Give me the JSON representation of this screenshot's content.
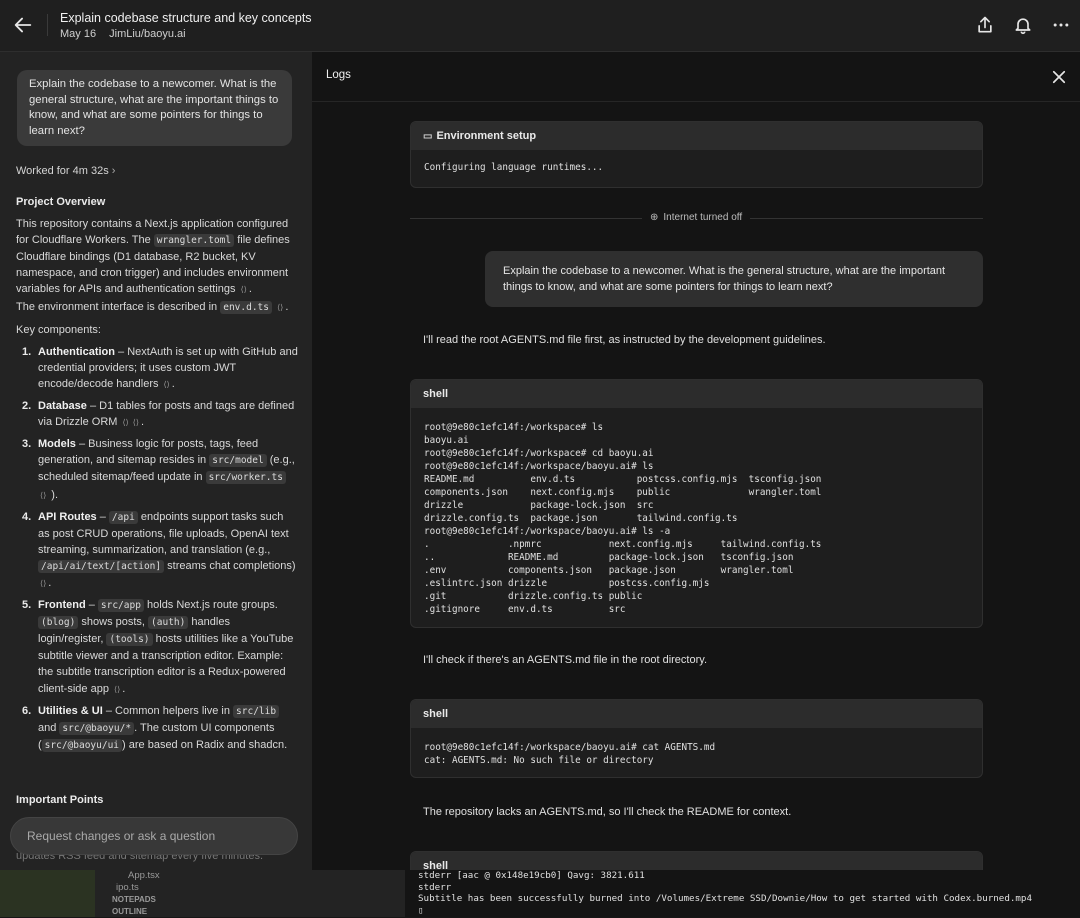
{
  "header": {
    "title": "Explain codebase structure and key concepts",
    "date": "May 16",
    "repo": "JimLiu/baoyu.ai"
  },
  "sidebar": {
    "user_prompt": "Explain the codebase to a newcomer. What is the general structure, what are the important things to know, and what are some pointers for things to learn next?",
    "worked_for": "Worked for 4m 32s",
    "overview_heading": "Project Overview",
    "overview_p1a": "This repository contains a Next.js application configured for Cloudflare Workers. The",
    "overview_code1": "wrangler.toml",
    "overview_p1b": "file defines Cloudflare bindings (D1 database, R2 bucket, KV namespace, and cron trigger) and includes environment variables for APIs and authentication settings",
    "overview_p2a": "The environment interface is described in",
    "overview_code2": "env.d.ts",
    "key_components_label": "Key components:",
    "components": [
      {
        "num": "1.",
        "name": "Authentication",
        "text": " – NextAuth is set up with GitHub and credential providers; it uses custom JWT encode/decode handlers"
      },
      {
        "num": "2.",
        "name": "Database",
        "text": " – D1 tables for posts and tags are defined via Drizzle ORM"
      },
      {
        "num": "3.",
        "name": "Models",
        "text": " – Business logic for posts, tags, feed generation, and sitemap resides in ",
        "code1": "src/model",
        "text2": " (e.g., scheduled sitemap/feed update in ",
        "code2": "src/worker.ts",
        "text3": " )."
      },
      {
        "num": "4.",
        "name": "API Routes",
        "text": " – ",
        "code1": "/api",
        "text2": " endpoints support tasks such as post CRUD operations, file uploads, OpenAI text streaming, summarization, and translation (e.g., ",
        "code2": "/api/ai/text/[action]",
        "text3": " streams chat completions)"
      },
      {
        "num": "5.",
        "name": "Frontend",
        "text": " – ",
        "code1": "src/app",
        "text2": " holds Next.js route groups. ",
        "code2": "(blog)",
        "text3": " shows posts, ",
        "code3": "(auth)",
        "text4": " handles login/register, ",
        "code4": "(tools)",
        "text5": " hosts utilities like a YouTube subtitle viewer and a transcription editor. Example: the subtitle transcription editor is a Redux-powered client-side app"
      },
      {
        "num": "6.",
        "name": "Utilities & UI",
        "text": " – Common helpers live in ",
        "code1": "src/lib",
        "text2": " and ",
        "code2": "src/@baoyu/*",
        "text3": ". The custom UI components (",
        "code3": "src/@baoyu/ui",
        "text4": ") are based on Radix and shadcn."
      }
    ],
    "important_heading": "Important Points",
    "input_placeholder": "Request changes or ask a question",
    "fade_text": "updates RSS feed and sitemap every five minutes."
  },
  "logs": {
    "title": "Logs",
    "env_card_title": "Environment setup",
    "env_card_body": "Configuring language runtimes...",
    "internet_label": "Internet turned off",
    "chat_message": "Explain the codebase to a newcomer. What is the general structure, what are the important things to know, and what are some pointers for things to learn next?",
    "narr1": "I'll read the root AGENTS.md file first, as instructed by the development guidelines.",
    "shell_label": "shell",
    "shell1": "root@9e80c1efc14f:/workspace# ls\nbaoyu.ai\nroot@9e80c1efc14f:/workspace# cd baoyu.ai\nroot@9e80c1efc14f:/workspace/baoyu.ai# ls\nREADME.md          env.d.ts           postcss.config.mjs  tsconfig.json\ncomponents.json    next.config.mjs    public              wrangler.toml\ndrizzle            package-lock.json  src\ndrizzle.config.ts  package.json       tailwind.config.ts\nroot@9e80c1efc14f:/workspace/baoyu.ai# ls -a\n.              .npmrc            next.config.mjs     tailwind.config.ts\n..             README.md         package-lock.json   tsconfig.json\n.env           components.json   package.json        wrangler.toml\n.eslintrc.json drizzle           postcss.config.mjs\n.git           drizzle.config.ts public\n.gitignore     env.d.ts          src",
    "narr2": "I'll check if there's an AGENTS.md file in the root directory.",
    "shell2": "root@9e80c1efc14f:/workspace/baoyu.ai# cat AGENTS.md\ncat: AGENTS.md: No such file or directory",
    "narr3": "The repository lacks an AGENTS.md, so I'll check the README for context.",
    "shell3_label": "shell"
  },
  "terminal": {
    "files": [
      "App.tsx",
      "ipo.ts",
      "NOTEPADS",
      "OUTLINE"
    ],
    "output": "stderr [aac @ 0x148e19cb0] Qavg: 3821.611\nstderr\nSubtitle has been successfully burned into /Volumes/Extreme SSD/Downie/How to get started with Codex.burned.mp4\n▯"
  },
  "icons": {
    "back": "arrow-left-icon",
    "share": "share-icon",
    "bell": "bell-icon",
    "more": "more-icon",
    "close": "close-icon",
    "laptop": "laptop-icon",
    "globe": "globe-icon"
  }
}
